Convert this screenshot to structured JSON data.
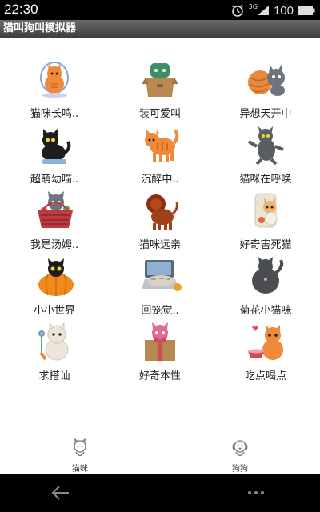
{
  "status": {
    "time": "22:30",
    "network": "3G",
    "battery_label": "100"
  },
  "app": {
    "title": "猫叫狗叫模拟器"
  },
  "colors": {
    "title_bar": "#4f4f4f",
    "status_bar": "#000000",
    "background": "#ffffff",
    "cat_orange": "#f08a3a",
    "cat_gray": "#6f7480"
  },
  "grid": {
    "items": [
      {
        "label": "猫咪长鸣..",
        "icon": "cat-in-cage-icon"
      },
      {
        "label": "装可爱叫",
        "icon": "cat-in-box-icon"
      },
      {
        "label": "异想天开中",
        "icon": "cat-with-yarn-icon"
      },
      {
        "label": "超萌幼喵..",
        "icon": "black-kitten-icon"
      },
      {
        "label": "沉醉中..",
        "icon": "orange-cat-walking-icon"
      },
      {
        "label": "猫咪在呼唤",
        "icon": "gray-cat-calling-icon"
      },
      {
        "label": "我是汤姆..",
        "icon": "cat-in-basket-icon"
      },
      {
        "label": "猫咪远亲",
        "icon": "lion-icon"
      },
      {
        "label": "好奇害死猫",
        "icon": "curious-cat-icon"
      },
      {
        "label": "小小世界",
        "icon": "cat-on-pumpkin-icon"
      },
      {
        "label": "回笼觉..",
        "icon": "cat-on-laptop-icon"
      },
      {
        "label": "菊花小猫咪",
        "icon": "cat-back-view-icon"
      },
      {
        "label": "求搭讪",
        "icon": "cat-with-flower-icon"
      },
      {
        "label": "好奇本性",
        "icon": "cat-in-gift-box-icon"
      },
      {
        "label": "吃点喝点",
        "icon": "cat-with-bowl-icon"
      }
    ]
  },
  "tabs": [
    {
      "label": "猫咪",
      "icon": "cat-tab-icon"
    },
    {
      "label": "狗狗",
      "icon": "dog-tab-icon"
    }
  ],
  "nav": {
    "back": "back-arrow-icon",
    "menu": "more-dots-icon"
  }
}
